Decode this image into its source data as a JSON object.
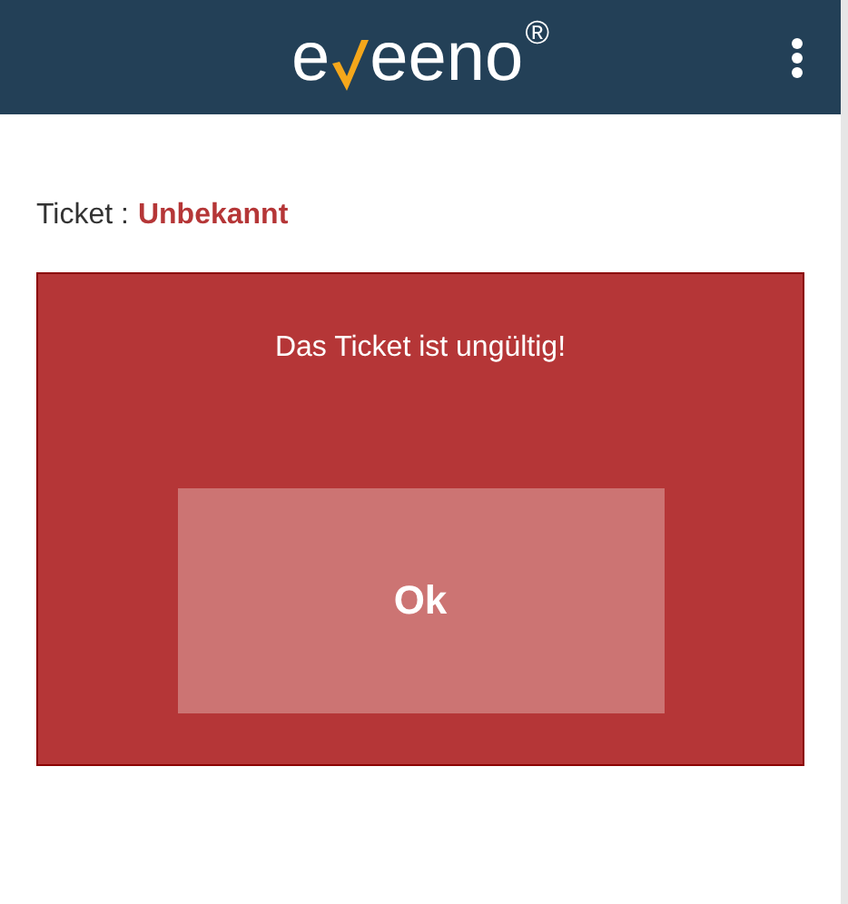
{
  "header": {
    "logo": {
      "start": "e",
      "end": "eeno",
      "mark": "®"
    }
  },
  "ticket": {
    "label": "Ticket :",
    "status": "Unbekannt"
  },
  "alert": {
    "message": "Das Ticket ist ungültig!",
    "button": "Ok"
  }
}
